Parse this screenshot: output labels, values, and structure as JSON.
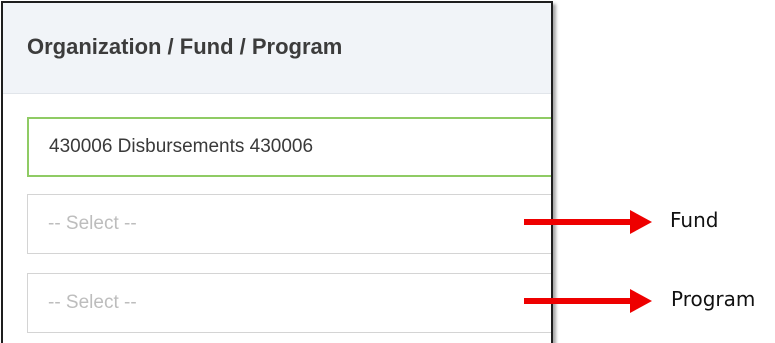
{
  "panel": {
    "title": "Organization / Fund / Program",
    "organization_value": "430006 Disbursements 430006",
    "fund_placeholder": "-- Select --",
    "program_placeholder": "-- Select --"
  },
  "annotations": {
    "fund_label": "Fund",
    "program_label": "Program",
    "arrow_color": "#ee0000"
  },
  "colors": {
    "selected_border": "#8fcb64",
    "header_bg": "#f1f4f8"
  }
}
